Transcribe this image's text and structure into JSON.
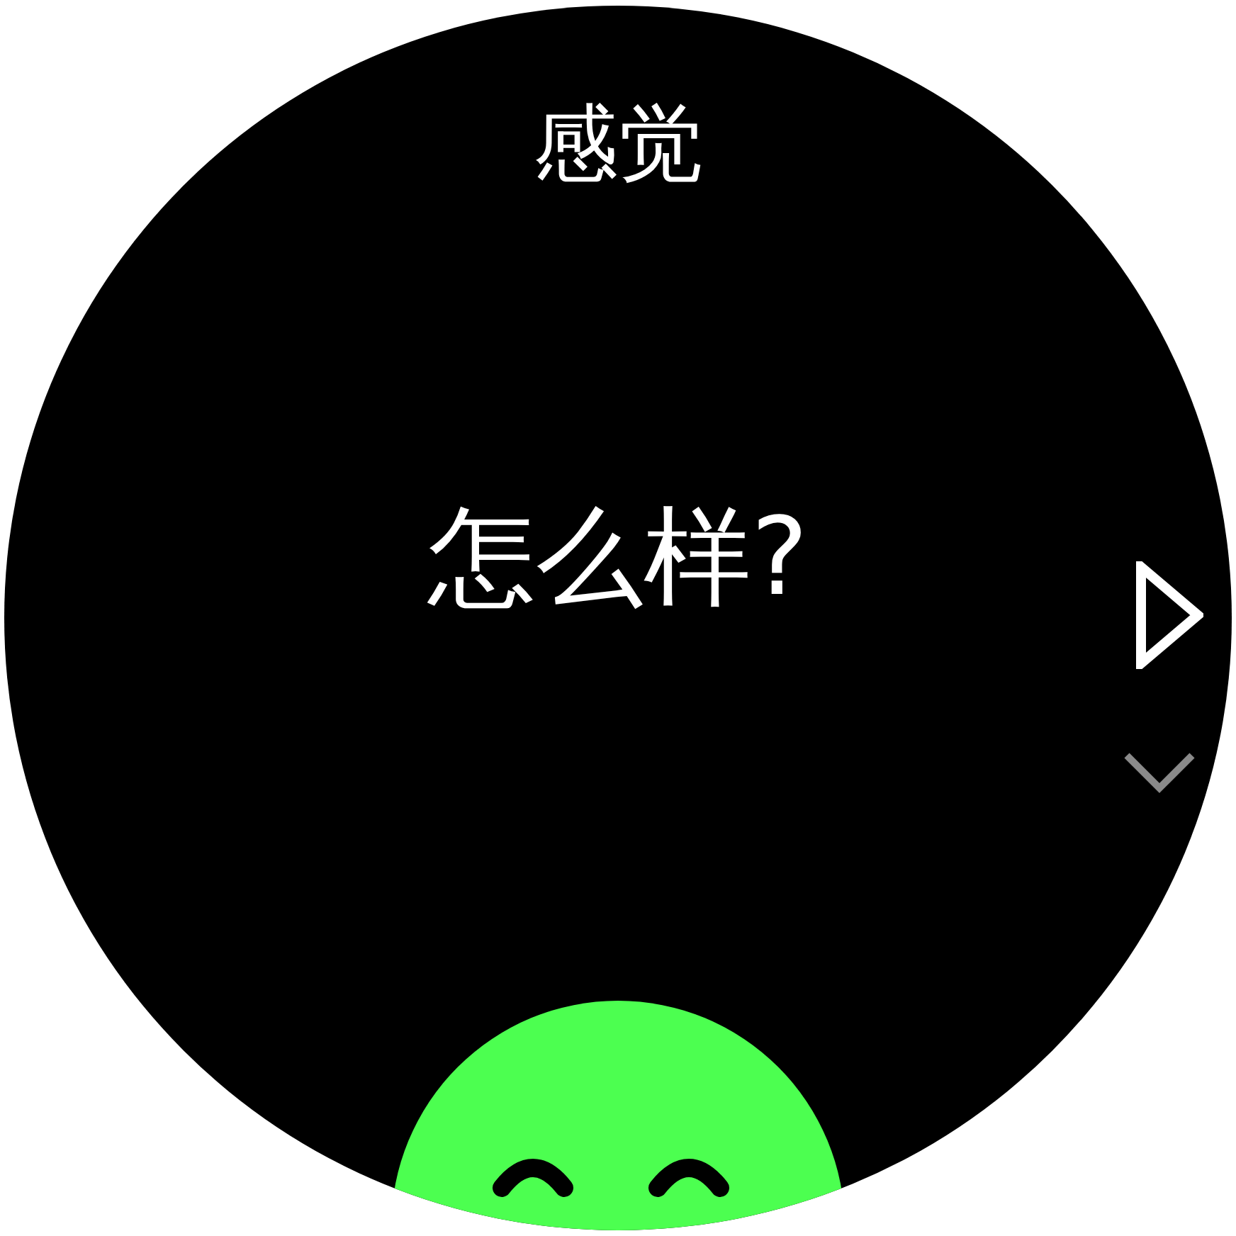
{
  "title": "感觉",
  "prompt": "怎么样?"
}
